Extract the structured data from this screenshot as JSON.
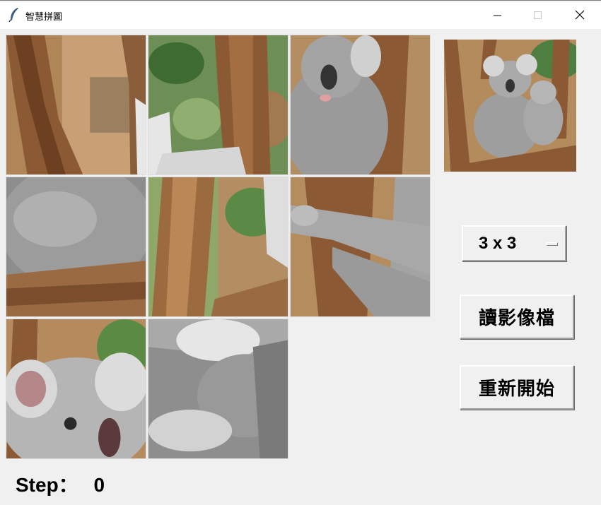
{
  "window": {
    "title": "智慧拼圖",
    "icon": "feather-icon",
    "controls": [
      "minimize-icon",
      "maximize-icon",
      "close-icon"
    ]
  },
  "puzzle": {
    "grid": "3 x 3",
    "tiles": [
      {
        "position": 1,
        "content": "tree-branch"
      },
      {
        "position": 2,
        "content": "tree-trunk-leaves"
      },
      {
        "position": 3,
        "content": "koala-face-top"
      },
      {
        "position": 4,
        "content": "koala-fur-branch"
      },
      {
        "position": 5,
        "content": "tree-trunk"
      },
      {
        "position": 6,
        "content": "koala-paw-trunk"
      },
      {
        "position": 7,
        "content": "baby-koala-face"
      },
      {
        "position": 8,
        "content": "koala-fur-belly"
      },
      {
        "position": 9,
        "content": "empty"
      }
    ]
  },
  "preview": {
    "icon": "koala-preview-image"
  },
  "controls": {
    "size_value": "3 x 3",
    "load_button": "讀影像檔",
    "restart_button": "重新開始"
  },
  "status": {
    "step_label": "Step：",
    "step_value": "0"
  },
  "colors": {
    "background": "#f0f0f0",
    "titlebar": "#ffffff",
    "bark": "#8b5a35",
    "fur": "#9a9a9a",
    "leaves": "#4d7a3c"
  }
}
